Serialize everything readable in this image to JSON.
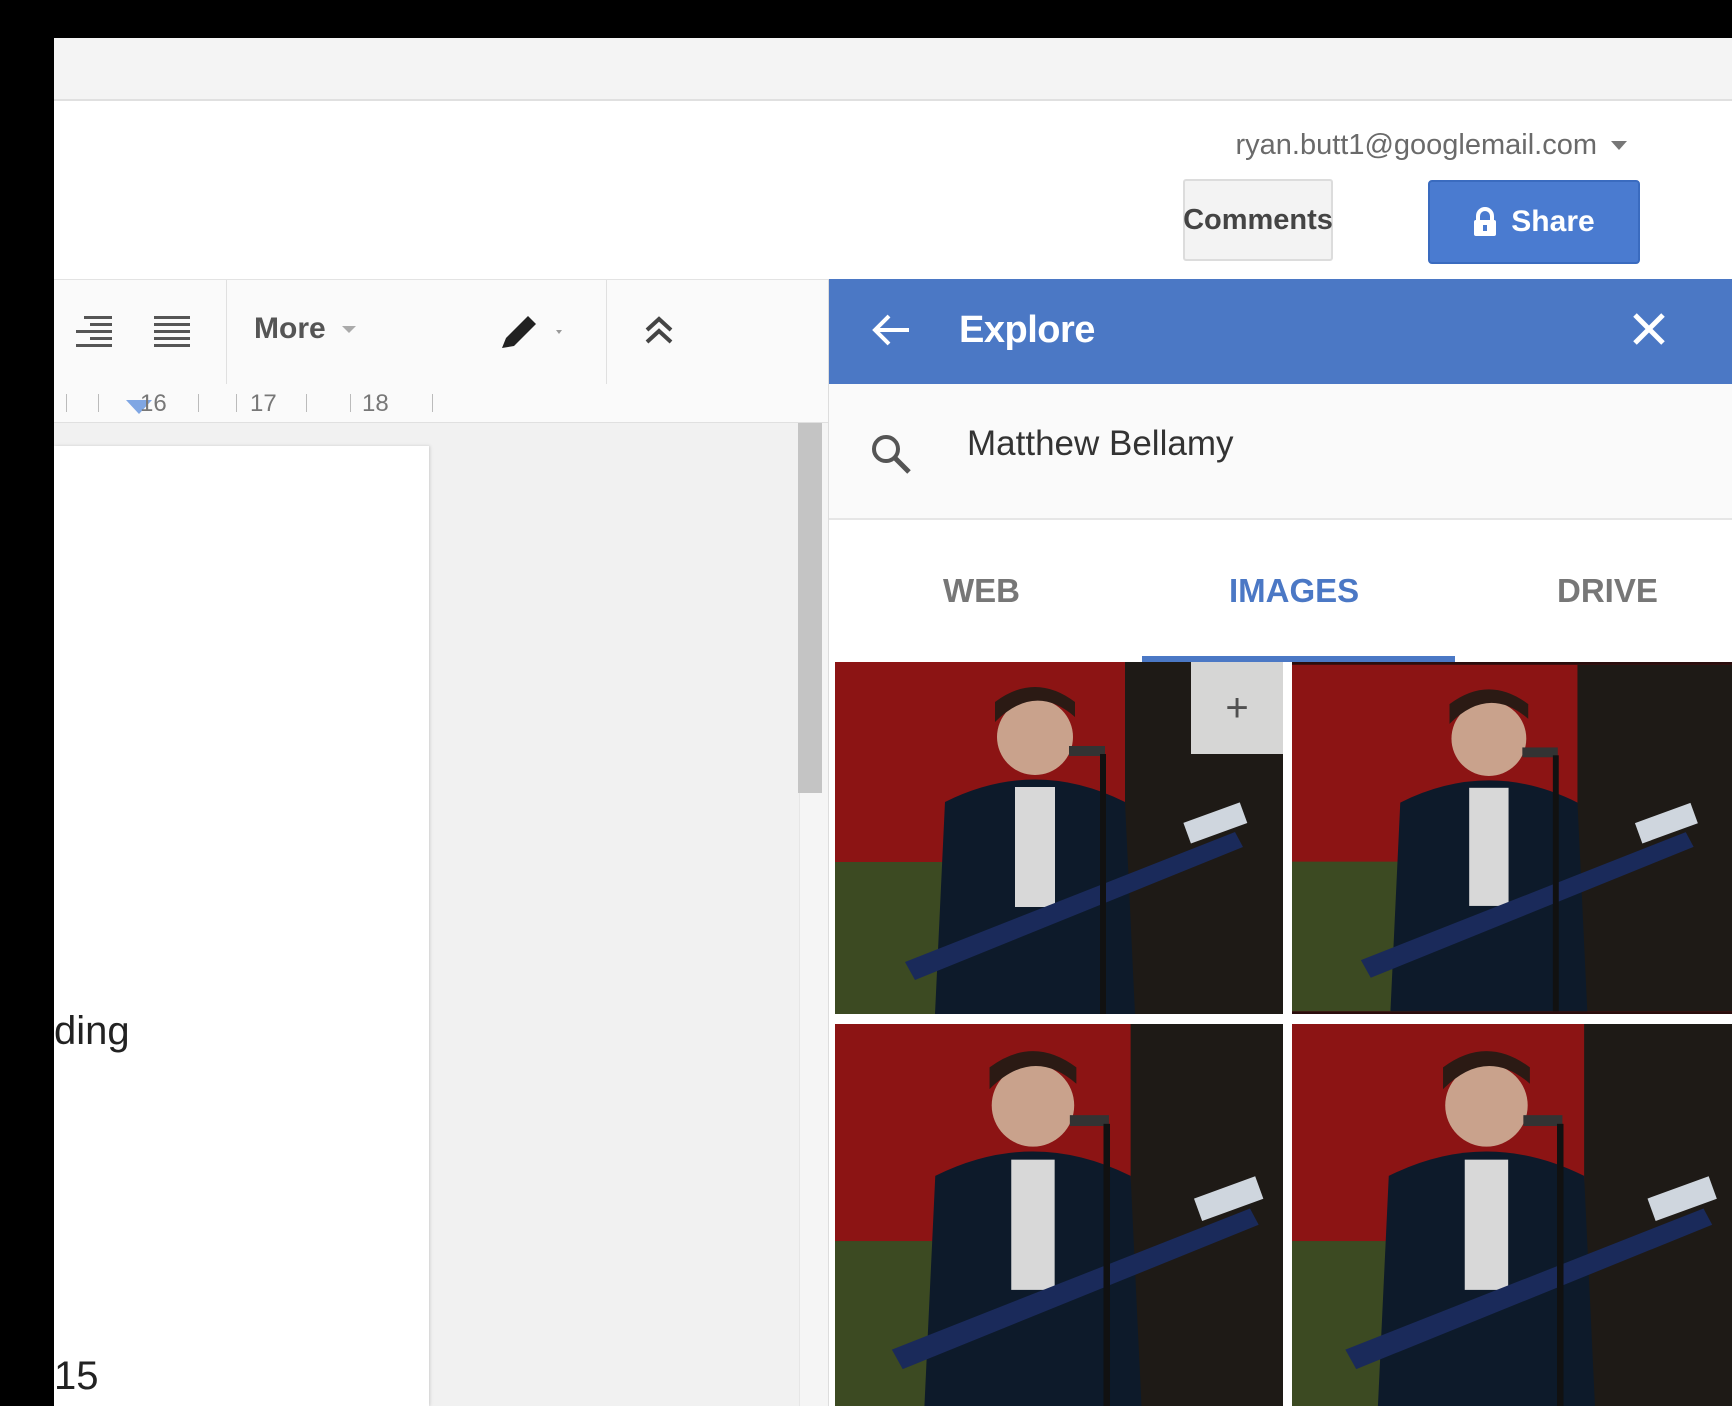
{
  "header": {
    "account_email": "ryan.butt1@googlemail.com",
    "comments_label": "Comments",
    "share_label": "Share"
  },
  "toolbar": {
    "more_label": "More"
  },
  "ruler": {
    "ticks": [
      "16",
      "17",
      "18"
    ]
  },
  "document": {
    "fragments": [
      "ding",
      "15"
    ]
  },
  "explore": {
    "title": "Explore",
    "search_value": "Matthew Bellamy",
    "tabs": [
      "WEB",
      "IMAGES",
      "DRIVE"
    ],
    "active_tab": "IMAGES",
    "add_label": "+"
  },
  "colors": {
    "accent": "#4b78c5",
    "share_button": "#4a7bd0"
  }
}
